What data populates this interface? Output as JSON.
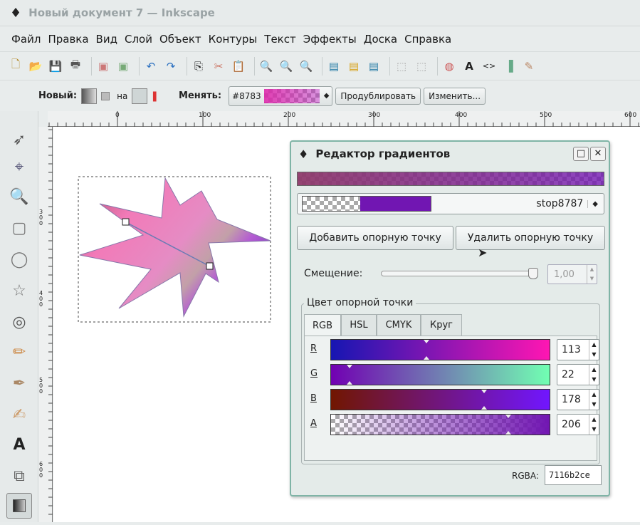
{
  "window": {
    "title": "Новый документ 7 — Inkscape"
  },
  "menu": [
    "Файл",
    "Правка",
    "Вид",
    "Слой",
    "Объект",
    "Контуры",
    "Текст",
    "Эффекты",
    "Доска",
    "Справка"
  ],
  "context_bar": {
    "new_label": "Новый:",
    "on_label": "на",
    "change_label": "Менять:",
    "gradient_id": "#8783",
    "duplicate_label": "Продублировать",
    "edit_label": "Изменить..."
  },
  "ruler": {
    "top_ticks": [
      "0",
      "100",
      "200",
      "300",
      "400",
      "500",
      "600"
    ],
    "left_ticks": [
      "300",
      "400",
      "500",
      "600"
    ]
  },
  "dialog": {
    "title": "Редактор градиентов",
    "stop_name": "stop8787",
    "add_stop": "Добавить опорную точку",
    "delete_stop": "Удалить опорную точку",
    "offset_label": "Смещение:",
    "offset_value": "1,00",
    "offset_fraction": 1.0,
    "stop_color_group": "Цвет опорной точки",
    "tabs": [
      "RGB",
      "HSL",
      "CMYK",
      "Круг"
    ],
    "active_tab": "RGB",
    "channels": [
      {
        "label": "R",
        "value": "113"
      },
      {
        "label": "G",
        "value": "22"
      },
      {
        "label": "B",
        "value": "178"
      },
      {
        "label": "A",
        "value": "206"
      }
    ],
    "rgba_label": "RGBA:",
    "rgba_value": "7116b2ce",
    "stop_color": "#7116b2"
  },
  "colors": {
    "gradient_start": "#8e3a6a",
    "gradient_end": "#7116b2",
    "star_pink": "#f06fb8",
    "star_violet": "#8a4fc4",
    "dialog_border": "#7fb4a6"
  }
}
